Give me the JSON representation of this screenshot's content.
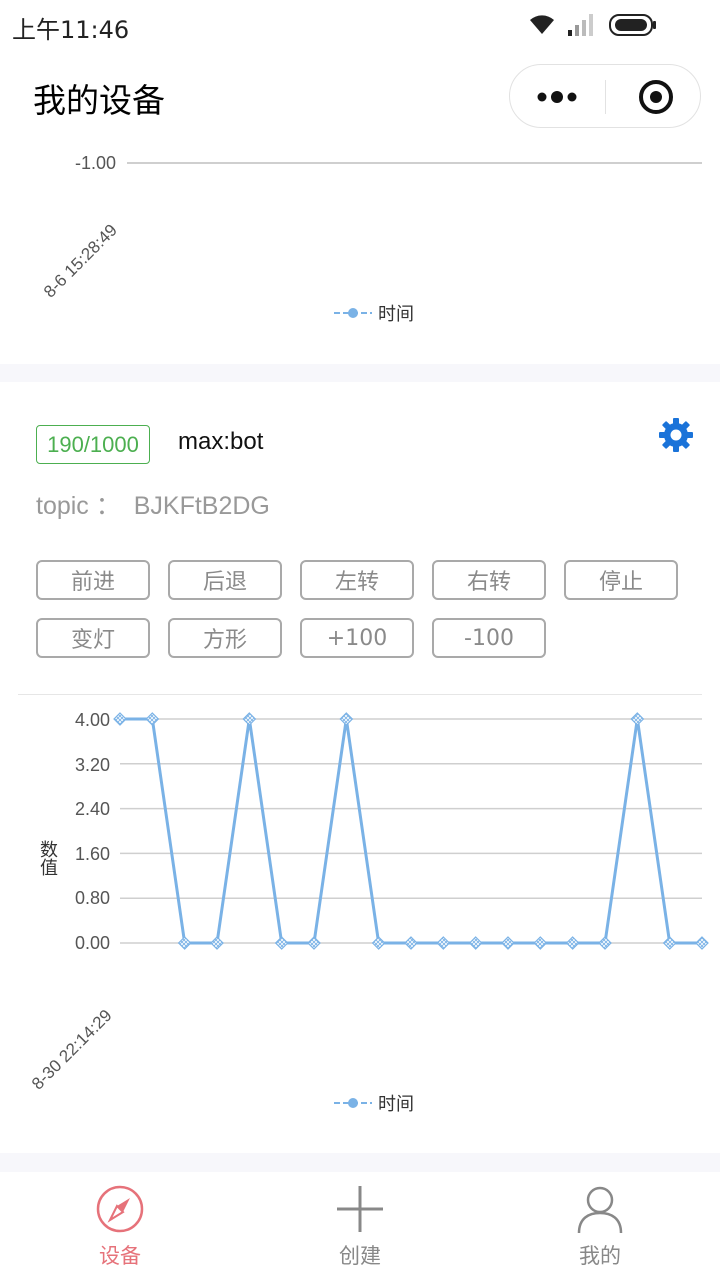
{
  "status_bar": {
    "time": "上午11:46",
    "icons": [
      "wifi-icon",
      "signal-icon",
      "battery-icon"
    ]
  },
  "nav": {
    "title": "我的设备",
    "capsule": [
      "more-icon",
      "close-icon"
    ]
  },
  "device_top": {
    "chart": {
      "y_tick": "-1.00",
      "x_date": "8-6 15:28:49",
      "legend": "时间"
    }
  },
  "device": {
    "counter": "190/1000",
    "name": "max:bot",
    "topic_label": "topic ：",
    "topic_value": "BJKFtB2DG",
    "commands": [
      "前进",
      "后退",
      "左转",
      "右转",
      "停止",
      "变灯",
      "方形",
      "+100",
      "-100"
    ],
    "chart": {
      "y_axis_title": "数值",
      "y_ticks": [
        "4.00",
        "3.20",
        "2.40",
        "1.60",
        "0.80",
        "0.00"
      ],
      "x_date": "8-30 22:14:29",
      "legend": "时间"
    }
  },
  "chart_data": [
    {
      "type": "line",
      "ylim": [
        -1,
        -1
      ],
      "y_ticks": [
        -1.0
      ],
      "x": [
        "8-6 15:28:49"
      ],
      "series": [
        {
          "name": "时间",
          "values": []
        }
      ],
      "legend": "bottom",
      "color": "#7ab2e6"
    },
    {
      "type": "line",
      "ylabel": "数值",
      "ylim": [
        0,
        4
      ],
      "y_ticks": [
        0.0,
        0.8,
        1.6,
        2.4,
        3.2,
        4.0
      ],
      "x": [
        "8-30 22:14:29"
      ],
      "series": [
        {
          "name": "时间",
          "values": [
            4,
            4,
            0,
            0,
            4,
            0,
            0,
            4,
            0,
            0,
            0,
            0,
            0,
            0,
            0,
            0,
            4,
            0,
            0
          ]
        }
      ],
      "legend": "bottom",
      "color": "#7ab2e6"
    }
  ],
  "tabbar": {
    "items": [
      {
        "label": "设备",
        "icon": "compass-icon",
        "active": true
      },
      {
        "label": "创建",
        "icon": "plus-icon",
        "active": false
      },
      {
        "label": "我的",
        "icon": "user-icon",
        "active": false
      }
    ],
    "active_color": "#e6727a",
    "inactive_color": "#888888"
  }
}
